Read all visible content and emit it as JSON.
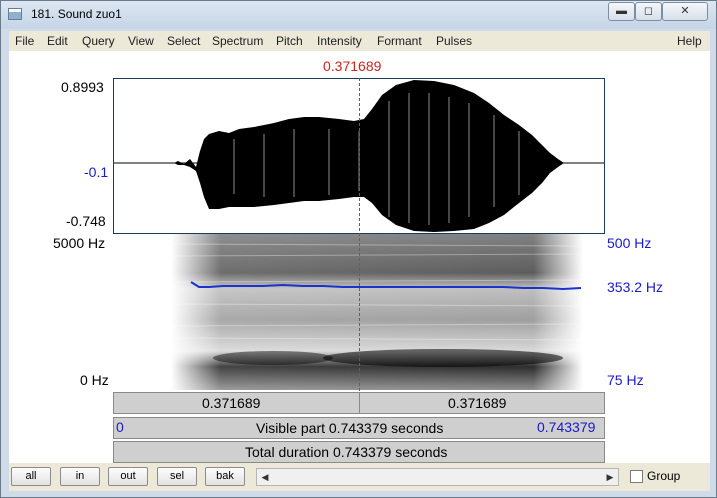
{
  "window": {
    "title": "181. Sound zuo1"
  },
  "menu": [
    "File",
    "Edit",
    "Query",
    "View",
    "Select",
    "Spectrum",
    "Pitch",
    "Intensity",
    "Formant",
    "Pulses",
    "Help"
  ],
  "cursor_time": "0.371689",
  "waveform": {
    "y_top": "0.8993",
    "y_mid": "-0.1",
    "y_bottom": "-0.748"
  },
  "spectrogram": {
    "freq_top": "5000 Hz",
    "freq_bottom": "0 Hz",
    "pitch_top": "500 Hz",
    "pitch_value": "353.2 Hz",
    "pitch_bottom": "75 Hz"
  },
  "time_bar": {
    "left_segment": "0.371689",
    "right_segment": "0.371689"
  },
  "visible_bar": {
    "start": "0",
    "label": "Visible part 0.743379 seconds",
    "end": "0.743379"
  },
  "total_bar": {
    "label": "Total duration 0.743379 seconds"
  },
  "buttons": {
    "all": "all",
    "in": "in",
    "out": "out",
    "sel": "sel",
    "bak": "bak"
  },
  "group_label": "Group",
  "colors": {
    "cursor": "#cc2222",
    "pitch": "#1a33cc",
    "blue_text": "#1a1acc"
  }
}
